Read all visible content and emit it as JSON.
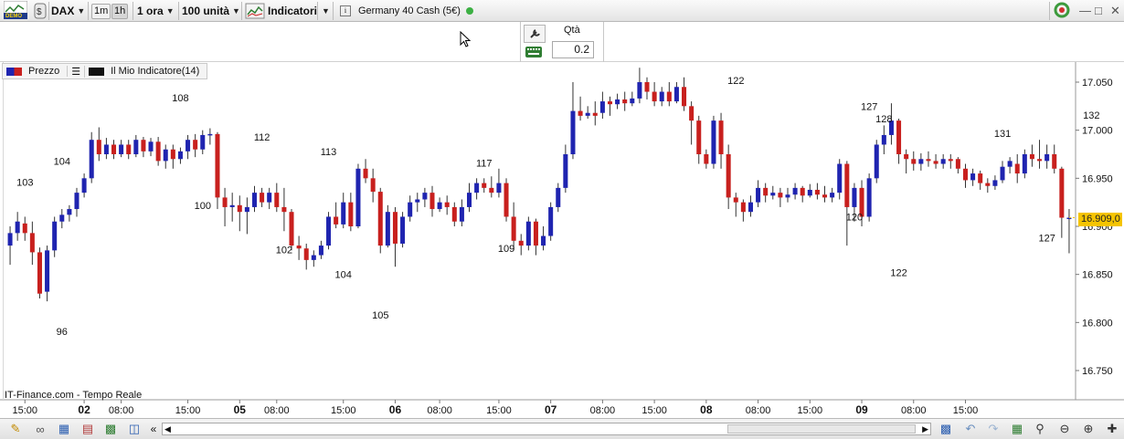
{
  "toolbar": {
    "demo_label": "DEMO",
    "instrument": "DAX",
    "btn_1m": "1m",
    "btn_1h": "1h",
    "interval": "1 ora",
    "units": "100 unità",
    "indicators": "Indicatori",
    "info_label": "Germany 40 Cash (5€)",
    "status_color": "#3cb043"
  },
  "order_panel": {
    "qty_label": "Qtà",
    "qty_value": "0.2"
  },
  "legend": {
    "price": "Prezzo",
    "indicator": "Il Mio Indicatore(14)"
  },
  "footer": {
    "source": "IT-Finance.com - Tempo Reale"
  },
  "chart_data": {
    "type": "candlestick",
    "up_color": "#1f24b0",
    "down_color": "#c8201e",
    "last_price": "16.909,0",
    "last_price_value": 16909,
    "ylim": [
      16715,
      17080
    ],
    "y_ticks": [
      {
        "value": 17050,
        "label": "17.050"
      },
      {
        "value": 17000,
        "label": "17.000"
      },
      {
        "value": 16950,
        "label": "16.950"
      },
      {
        "value": 16900,
        "label": "16.900"
      },
      {
        "value": 16850,
        "label": "16.850"
      },
      {
        "value": 16800,
        "label": "16.800"
      },
      {
        "value": 16750,
        "label": "16.750"
      }
    ],
    "x_ticks": [
      {
        "index": 2,
        "label": "15:00",
        "major": false
      },
      {
        "index": 10,
        "label": "02",
        "major": true
      },
      {
        "index": 15,
        "label": "08:00",
        "major": false
      },
      {
        "index": 24,
        "label": "15:00",
        "major": false
      },
      {
        "index": 31,
        "label": "05",
        "major": true
      },
      {
        "index": 36,
        "label": "08:00",
        "major": false
      },
      {
        "index": 45,
        "label": "15:00",
        "major": false
      },
      {
        "index": 52,
        "label": "06",
        "major": true
      },
      {
        "index": 58,
        "label": "08:00",
        "major": false
      },
      {
        "index": 66,
        "label": "15:00",
        "major": false
      },
      {
        "index": 73,
        "label": "07",
        "major": true
      },
      {
        "index": 80,
        "label": "08:00",
        "major": false
      },
      {
        "index": 87,
        "label": "15:00",
        "major": false
      },
      {
        "index": 94,
        "label": "08",
        "major": true
      },
      {
        "index": 101,
        "label": "08:00",
        "major": false
      },
      {
        "index": 108,
        "label": "15:00",
        "major": false
      },
      {
        "index": 115,
        "label": "09",
        "major": true
      },
      {
        "index": 122,
        "label": "08:00",
        "major": false
      },
      {
        "index": 129,
        "label": "15:00",
        "major": false
      }
    ],
    "candles": [
      [
        16880,
        16893,
        16860,
        16900
      ],
      [
        16893,
        16905,
        16885,
        16915
      ],
      [
        16903,
        16893,
        16885,
        16910
      ],
      [
        16893,
        16873,
        16860,
        16905
      ],
      [
        16873,
        16830,
        16825,
        16878
      ],
      [
        16832,
        16875,
        16822,
        16880
      ],
      [
        16875,
        16905,
        16868,
        16910
      ],
      [
        16905,
        16912,
        16898,
        16918
      ],
      [
        16912,
        16918,
        16905,
        16922
      ],
      [
        16918,
        16935,
        16910,
        16940
      ],
      [
        16935,
        16950,
        16930,
        16955
      ],
      [
        16950,
        16990,
        16945,
        16998
      ],
      [
        16990,
        16975,
        16968,
        17003
      ],
      [
        16975,
        16985,
        16970,
        16992
      ],
      [
        16985,
        16975,
        16970,
        16990
      ],
      [
        16975,
        16985,
        16972,
        16990
      ],
      [
        16985,
        16975,
        16970,
        16990
      ],
      [
        16975,
        16990,
        16972,
        16995
      ],
      [
        16990,
        16978,
        16972,
        16993
      ],
      [
        16978,
        16988,
        16973,
        16992
      ],
      [
        16988,
        16968,
        16963,
        16993
      ],
      [
        16968,
        16980,
        16960,
        16985
      ],
      [
        16980,
        16970,
        16960,
        16985
      ],
      [
        16970,
        16978,
        16965,
        16982
      ],
      [
        16978,
        16990,
        16970,
        16995
      ],
      [
        16990,
        16980,
        16972,
        16996
      ],
      [
        16980,
        16995,
        16975,
        17000
      ],
      [
        16995,
        16996,
        16985,
        17002
      ],
      [
        16996,
        16930,
        16918,
        16998
      ],
      [
        16930,
        16920,
        16900,
        16940
      ],
      [
        16920,
        16922,
        16905,
        16935
      ],
      [
        16922,
        16915,
        16895,
        16932
      ],
      [
        16915,
        16920,
        16892,
        16930
      ],
      [
        16920,
        16935,
        16915,
        16942
      ],
      [
        16935,
        16925,
        16920,
        16940
      ],
      [
        16925,
        16935,
        16918,
        16940
      ],
      [
        16935,
        16920,
        16915,
        16945
      ],
      [
        16920,
        16915,
        16895,
        16940
      ],
      [
        16915,
        16880,
        16875,
        16918
      ],
      [
        16880,
        16877,
        16865,
        16890
      ],
      [
        16877,
        16865,
        16855,
        16882
      ],
      [
        16865,
        16870,
        16858,
        16875
      ],
      [
        16870,
        16880,
        16866,
        16885
      ],
      [
        16880,
        16910,
        16876,
        16915
      ],
      [
        16910,
        16902,
        16898,
        16925
      ],
      [
        16902,
        16925,
        16898,
        16935
      ],
      [
        16925,
        16900,
        16895,
        16935
      ],
      [
        16900,
        16960,
        16898,
        16965
      ],
      [
        16960,
        16950,
        16945,
        16970
      ],
      [
        16950,
        16936,
        16925,
        16960
      ],
      [
        16936,
        16880,
        16872,
        16940
      ],
      [
        16880,
        16915,
        16878,
        16922
      ],
      [
        16915,
        16882,
        16858,
        16920
      ],
      [
        16882,
        16910,
        16878,
        16915
      ],
      [
        16910,
        16925,
        16905,
        16932
      ],
      [
        16925,
        16928,
        16915,
        16935
      ],
      [
        16928,
        16935,
        16920,
        16940
      ],
      [
        16935,
        16918,
        16910,
        16942
      ],
      [
        16918,
        16925,
        16915,
        16930
      ],
      [
        16925,
        16920,
        16912,
        16932
      ],
      [
        16920,
        16905,
        16900,
        16925
      ],
      [
        16905,
        16920,
        16900,
        16928
      ],
      [
        16920,
        16935,
        16915,
        16945
      ],
      [
        16935,
        16945,
        16928,
        16950
      ],
      [
        16945,
        16940,
        16935,
        16950
      ],
      [
        16940,
        16935,
        16930,
        16952
      ],
      [
        16935,
        16945,
        16930,
        16960
      ],
      [
        16945,
        16910,
        16905,
        16950
      ],
      [
        16910,
        16885,
        16875,
        16925
      ],
      [
        16885,
        16880,
        16870,
        16892
      ],
      [
        16880,
        16905,
        16875,
        16910
      ],
      [
        16905,
        16880,
        16870,
        16908
      ],
      [
        16880,
        16890,
        16875,
        16900
      ],
      [
        16890,
        16920,
        16885,
        16925
      ],
      [
        16920,
        16940,
        16915,
        16945
      ],
      [
        16940,
        16975,
        16935,
        16985
      ],
      [
        16975,
        17020,
        16970,
        17050
      ],
      [
        17020,
        17015,
        17010,
        17035
      ],
      [
        17015,
        17018,
        17012,
        17025
      ],
      [
        17018,
        17015,
        17005,
        17030
      ],
      [
        17018,
        17030,
        17012,
        17040
      ],
      [
        17030,
        17027,
        17015,
        17035
      ],
      [
        17027,
        17032,
        17022,
        17038
      ],
      [
        17032,
        17028,
        17020,
        17040
      ],
      [
        17028,
        17033,
        17025,
        17040
      ],
      [
        17033,
        17050,
        17028,
        17065
      ],
      [
        17050,
        17040,
        17032,
        17055
      ],
      [
        17040,
        17030,
        17025,
        17050
      ],
      [
        17030,
        17040,
        17025,
        17045
      ],
      [
        17040,
        17030,
        17025,
        17050
      ],
      [
        17030,
        17045,
        17028,
        17050
      ],
      [
        17045,
        17025,
        17020,
        17055
      ],
      [
        17025,
        17010,
        16985,
        17030
      ],
      [
        17010,
        16975,
        16965,
        17015
      ],
      [
        16975,
        16965,
        16960,
        16980
      ],
      [
        16965,
        17010,
        16960,
        17015
      ],
      [
        17010,
        16975,
        16960,
        17018
      ],
      [
        16975,
        16930,
        16918,
        16985
      ],
      [
        16930,
        16925,
        16910,
        16935
      ],
      [
        16925,
        16915,
        16905,
        16928
      ],
      [
        16915,
        16925,
        16910,
        16932
      ],
      [
        16925,
        16940,
        16920,
        16948
      ],
      [
        16940,
        16932,
        16925,
        16945
      ],
      [
        16932,
        16935,
        16928,
        16942
      ],
      [
        16935,
        16930,
        16920,
        16940
      ],
      [
        16930,
        16933,
        16925,
        16940
      ],
      [
        16933,
        16940,
        16928,
        16945
      ],
      [
        16940,
        16932,
        16925,
        16942
      ],
      [
        16932,
        16938,
        16930,
        16944
      ],
      [
        16938,
        16933,
        16928,
        16945
      ],
      [
        16933,
        16930,
        16925,
        16942
      ],
      [
        16930,
        16935,
        16925,
        16940
      ],
      [
        16935,
        16965,
        16928,
        16970
      ],
      [
        16965,
        16920,
        16880,
        16968
      ],
      [
        16920,
        16940,
        16905,
        16945
      ],
      [
        16940,
        16910,
        16900,
        16948
      ],
      [
        16910,
        16950,
        16905,
        16955
      ],
      [
        16950,
        16985,
        16945,
        16990
      ],
      [
        16985,
        16995,
        16975,
        17005
      ],
      [
        16995,
        17010,
        16985,
        17028
      ],
      [
        17010,
        16975,
        16965,
        17012
      ],
      [
        16975,
        16970,
        16955,
        16980
      ],
      [
        16970,
        16965,
        16958,
        16978
      ],
      [
        16965,
        16970,
        16958,
        16976
      ],
      [
        16970,
        16968,
        16962,
        16978
      ],
      [
        16968,
        16965,
        16960,
        16975
      ],
      [
        16965,
        16970,
        16960,
        16975
      ],
      [
        16970,
        16968,
        16960,
        16975
      ],
      [
        16970,
        16960,
        16955,
        16972
      ],
      [
        16960,
        16948,
        16940,
        16965
      ],
      [
        16948,
        16955,
        16942,
        16960
      ],
      [
        16955,
        16945,
        16938,
        16958
      ],
      [
        16945,
        16942,
        16935,
        16950
      ],
      [
        16942,
        16948,
        16938,
        16953
      ],
      [
        16948,
        16962,
        16945,
        16968
      ],
      [
        16962,
        16968,
        16955,
        16972
      ],
      [
        16965,
        16955,
        16945,
        16975
      ],
      [
        16955,
        16975,
        16950,
        16980
      ],
      [
        16975,
        16970,
        16962,
        16985
      ],
      [
        16970,
        16968,
        16960,
        16990
      ],
      [
        16968,
        16975,
        16960,
        16985
      ],
      [
        16975,
        16960,
        16955,
        16985
      ],
      [
        16960,
        16909,
        16888,
        16962
      ],
      [
        16909,
        16909,
        16872,
        16918
      ]
    ],
    "annotations": [
      {
        "index": 2,
        "value": 16946,
        "label": "103"
      },
      {
        "index": 7,
        "value": 16968,
        "label": "104"
      },
      {
        "index": 7,
        "value": 16791,
        "label": "96"
      },
      {
        "index": 23,
        "value": 17034,
        "label": "108"
      },
      {
        "index": 26,
        "value": 16922,
        "label": "100"
      },
      {
        "index": 34,
        "value": 16993,
        "label": "112"
      },
      {
        "index": 37,
        "value": 16876,
        "label": "102"
      },
      {
        "index": 43,
        "value": 16978,
        "label": "113"
      },
      {
        "index": 45,
        "value": 16850,
        "label": "104"
      },
      {
        "index": 50,
        "value": 16808,
        "label": "105"
      },
      {
        "index": 64,
        "value": 16966,
        "label": "117"
      },
      {
        "index": 67,
        "value": 16877,
        "label": "109"
      },
      {
        "index": 98,
        "value": 17052,
        "label": "122"
      },
      {
        "index": 114,
        "value": 16910,
        "label": "120"
      },
      {
        "index": 116,
        "value": 17025,
        "label": "127"
      },
      {
        "index": 118,
        "value": 17012,
        "label": "128"
      },
      {
        "index": 120,
        "value": 16852,
        "label": "122"
      },
      {
        "index": 134,
        "value": 16997,
        "label": "131"
      },
      {
        "index": 140,
        "value": 16888,
        "label": "127"
      },
      {
        "index": 146,
        "value": 17016,
        "label": "132"
      }
    ]
  }
}
